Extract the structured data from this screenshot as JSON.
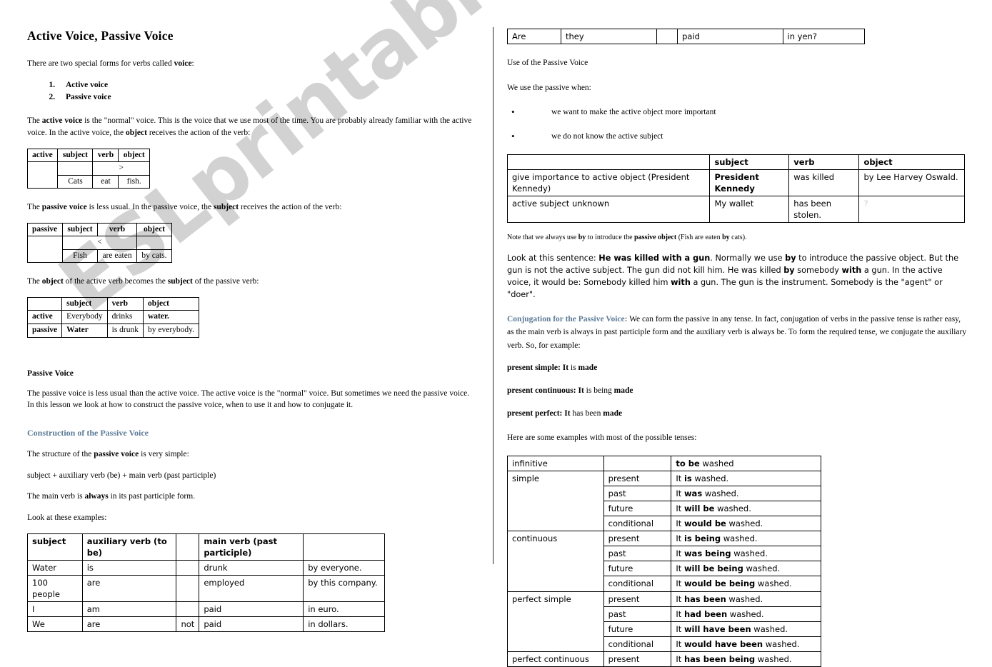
{
  "watermark": {
    "text": "ESLprintables.com"
  },
  "colors": {
    "heading_blue": "#5d7b97",
    "text": "#000000",
    "dim": "#cccccc"
  },
  "left": {
    "title": "Active Voice, Passive Voice",
    "intro_a": "There are two special forms for verbs called ",
    "intro_b": "voice",
    "intro_c": ":",
    "voice_list": [
      "Active voice",
      "Passive voice"
    ],
    "active_para": {
      "p1": "The ",
      "b1": "active voice",
      "p2": " is the \"normal\" voice. This is the voice that we use most of the time. You are probably already familiar with the active voice. In the active voice, the ",
      "b2": "object",
      "p3": " receives the action of the verb:"
    },
    "active_table": {
      "label": "active",
      "headers": [
        "subject",
        "verb",
        "object"
      ],
      "arrow": ">",
      "row": [
        "Cats",
        "eat",
        "fish."
      ]
    },
    "passive_para": {
      "p1": "The ",
      "b1": "passive voice",
      "p2": " is less usual. In the passive voice, the ",
      "b2": "subject",
      "p3": " receives the action of the verb:"
    },
    "passive_table": {
      "label": "passive",
      "headers": [
        "subject",
        "verb",
        "object"
      ],
      "arrow": "<",
      "row": [
        "Fish",
        "are eaten",
        "by cats."
      ]
    },
    "object_para": {
      "p1": "The ",
      "b1": "object",
      "p2": " of the active verb becomes the ",
      "b2": "subject",
      "p3": " of the passive verb:"
    },
    "compare_table": {
      "corner": "",
      "headers": [
        "subject",
        "verb",
        "object"
      ],
      "rows": [
        {
          "label": "active",
          "cells": [
            "Everybody",
            "drinks",
            "water."
          ]
        },
        {
          "label": "passive",
          "cells": [
            "Water",
            "is drunk",
            "by everybody."
          ]
        }
      ]
    },
    "section_heading": "Passive Voice",
    "section_para": "The passive voice is less usual than the active voice. The active voice is the \"normal\" voice. But sometimes we need the passive voice. In this lesson we look at how to construct the passive voice, when to use it and how to conjugate it.",
    "construction_heading": "Construction of the Passive Voice",
    "structure_para": {
      "p1": "The structure of the ",
      "b1": "passive voice",
      "p2": " is very simple:"
    },
    "formula": "subject + auxiliary verb (be) + main verb (past participle)",
    "always_para": {
      "p1": "The main verb is ",
      "b1": "always",
      "p2": " in its past participle form."
    },
    "look_examples": "Look at these examples:",
    "examples_table": {
      "headers": [
        "subject",
        "auxiliary verb (to be)",
        "",
        "main verb (past participle)",
        ""
      ],
      "rows": [
        [
          "Water",
          "is",
          "",
          "drunk",
          "by everyone."
        ],
        [
          "100 people",
          "are",
          "",
          "employed",
          "by this company."
        ],
        [
          "I",
          "am",
          "",
          "paid",
          "in euro."
        ],
        [
          "We",
          "are",
          "not",
          "paid",
          "in dollars."
        ]
      ]
    }
  },
  "right": {
    "continued_table": {
      "row": [
        "Are",
        "they",
        "",
        "paid",
        "in yen?"
      ]
    },
    "use_heading": "Use of the Passive Voice",
    "use_intro": "We use the passive when:",
    "use_bullets": [
      "we want to make the active object more important",
      "we do not know the active subject"
    ],
    "use_table": {
      "headers": [
        "",
        "subject",
        "verb",
        "object"
      ],
      "rows": [
        [
          "give importance to active object (President Kennedy)",
          "President Kennedy",
          "was killed",
          "by Lee Harvey Oswald."
        ],
        [
          "active subject unknown",
          "My wallet",
          "has been stolen.",
          "?"
        ]
      ]
    },
    "note": {
      "p1": "Note that we always use ",
      "b1": "by",
      "p2": " to introduce the ",
      "b2": "passive object",
      "p3": " (Fish are eaten ",
      "b3": "by",
      "p4": " cats)."
    },
    "gun_para": {
      "p1": "Look at this sentence:  ",
      "b1": "He was killed with a gun",
      "p2": ". Normally we use ",
      "b2": "by",
      "p3": " to introduce the passive object. But the gun is not the active subject. The gun did not kill him. He was killed ",
      "b3": "by",
      "p4": " somebody ",
      "b4": "with",
      "p5": " a gun. In the active voice, it would be: Somebody killed him ",
      "b5": "with",
      "p6": " a gun. The gun is the instrument. Somebody is the \"agent\" or \"doer\"."
    },
    "conjugation": {
      "heading": "Conjugation for the Passive Voice:",
      "body": " We can form the passive in any tense. In fact, conjugation of verbs in the passive tense is rather easy, as the main verb is always in past participle form and the auxiliary verb is always be. To form the required tense, we conjugate the auxiliary verb. So, for example:"
    },
    "tense_examples": [
      {
        "label": "present simple:",
        "b1": " It",
        "plain1": " is ",
        "b2": "made"
      },
      {
        "label": "present continuous:",
        "b1": " It",
        "plain1": " is being ",
        "b2": "made"
      },
      {
        "label": "present perfect:",
        "b1": " It",
        "plain1": " has been ",
        "b2": "made"
      }
    ],
    "examples_intro": "Here are some examples with most of the possible tenses:",
    "conjugation_table": {
      "rows": [
        {
          "group": "infinitive",
          "span": true,
          "tense": "",
          "bold": "to be",
          "plain": " washed"
        },
        {
          "group": "simple",
          "rowspan": 4,
          "tense": "present",
          "pre": "It ",
          "bold": "is",
          "plain": " washed."
        },
        {
          "group": "",
          "tense": "past",
          "pre": "It ",
          "bold": "was",
          "plain": " washed."
        },
        {
          "group": "",
          "tense": "future",
          "pre": "It ",
          "bold": "will be",
          "plain": " washed."
        },
        {
          "group": "",
          "tense": "conditional",
          "pre": "It ",
          "bold": "would be",
          "plain": " washed."
        },
        {
          "group": "continuous",
          "rowspan": 4,
          "tense": "present",
          "pre": "It ",
          "bold": "is being",
          "plain": " washed."
        },
        {
          "group": "",
          "tense": "past",
          "pre": "It ",
          "bold": "was being",
          "plain": " washed."
        },
        {
          "group": "",
          "tense": "future",
          "pre": "It ",
          "bold": "will be being",
          "plain": " washed."
        },
        {
          "group": "",
          "tense": "conditional",
          "pre": "It ",
          "bold": "would be being",
          "plain": " washed."
        },
        {
          "group": "perfect simple",
          "rowspan": 4,
          "tense": "present",
          "pre": "It ",
          "bold": "has been",
          "plain": " washed."
        },
        {
          "group": "",
          "tense": "past",
          "pre": "It ",
          "bold": "had been",
          "plain": " washed."
        },
        {
          "group": "",
          "tense": "future",
          "pre": "It ",
          "bold": "will have been",
          "plain": " washed."
        },
        {
          "group": "",
          "tense": "conditional",
          "pre": "It ",
          "bold": "would have been",
          "plain": " washed."
        },
        {
          "group": "perfect continuous",
          "rowspan": 1,
          "tense": "present",
          "pre": "It ",
          "bold": "has been being",
          "plain": " washed."
        }
      ]
    }
  }
}
